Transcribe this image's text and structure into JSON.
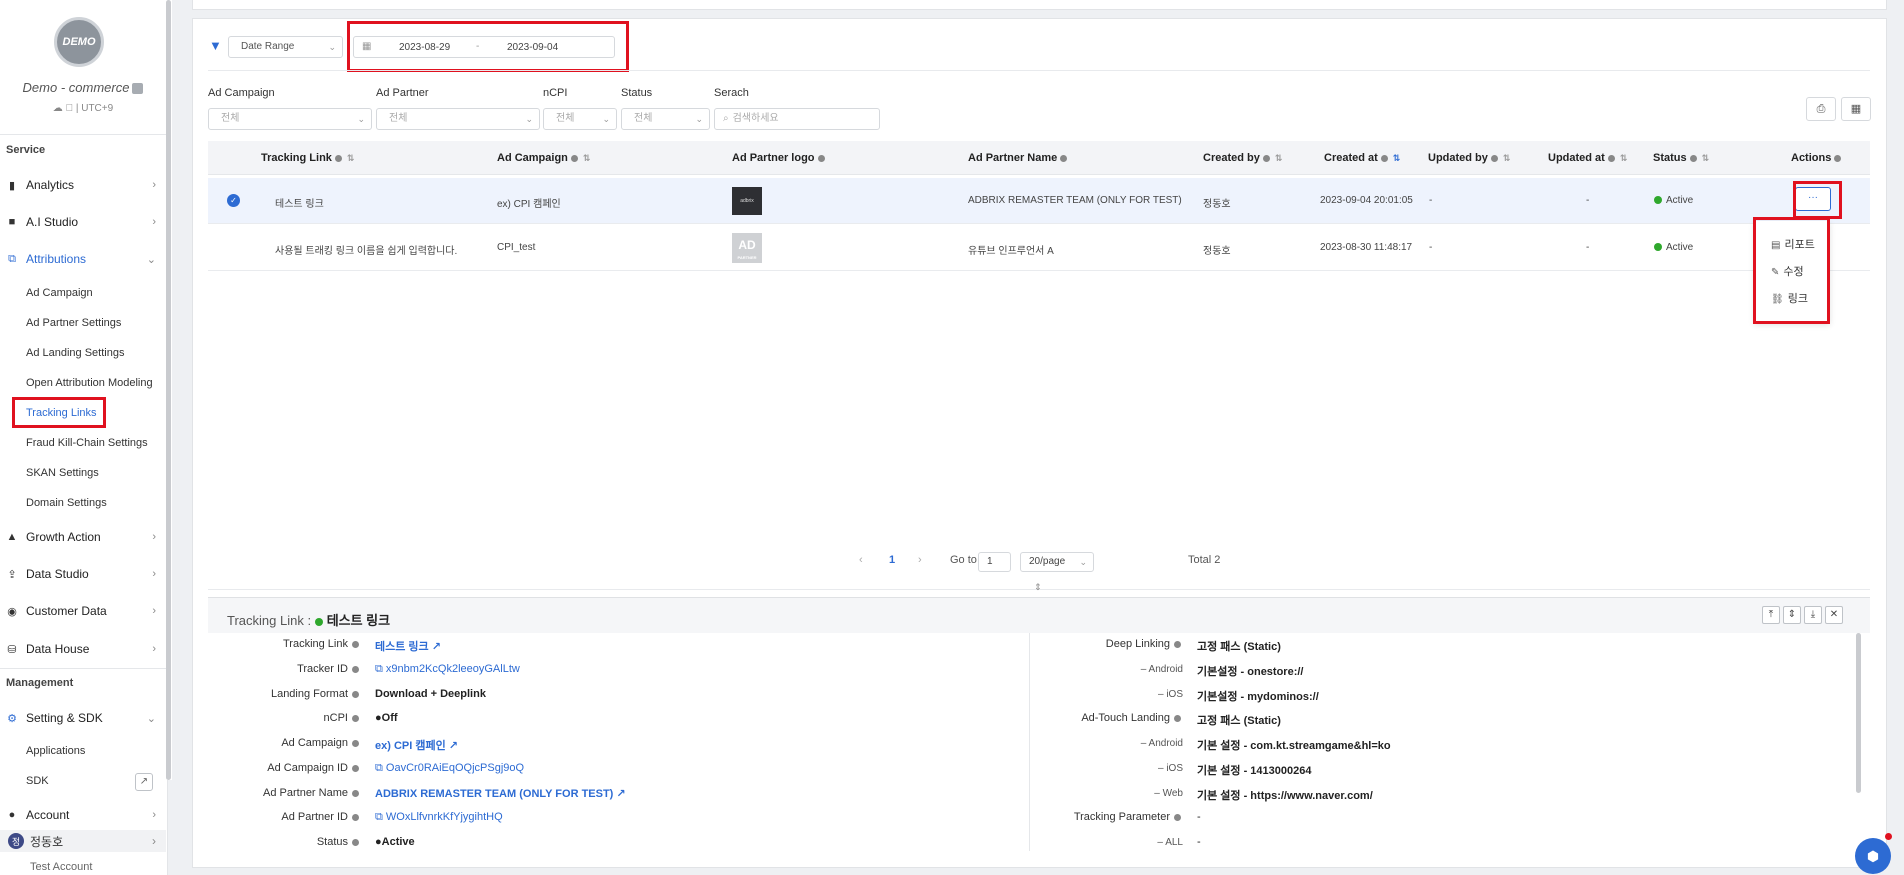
{
  "sidebar": {
    "avatar_text": "DEMO",
    "brand": "Demo - commerce",
    "platform_info": "☁  | UTC+9",
    "section_service": "Service",
    "section_management": "Management",
    "nav": {
      "analytics": "Analytics",
      "ai_studio": "A.I Studio",
      "attributions": "Attributions",
      "growth_action": "Growth Action",
      "data_studio": "Data Studio",
      "customer_data": "Customer Data",
      "data_house": "Data House",
      "setting_sdk": "Setting & SDK",
      "account": "Account"
    },
    "attributions_sub": {
      "ad_campaign": "Ad Campaign",
      "ad_partner_settings": "Ad Partner Settings",
      "ad_landing_settings": "Ad Landing Settings",
      "open_attribution": "Open Attribution Modeling",
      "tracking_links": "Tracking Links",
      "fraud_kill_chain": "Fraud Kill-Chain Settings",
      "skan_settings": "SKAN Settings",
      "domain_settings": "Domain Settings"
    },
    "setting_sub": {
      "applications": "Applications",
      "sdk": "SDK"
    },
    "user_badge": "정",
    "user_name": "정동호",
    "account_name": "Test Account"
  },
  "filters": {
    "date_type": "Date Range",
    "date_start": "2023-08-29",
    "date_sep": "-",
    "date_end": "2023-09-04",
    "labels": {
      "ad_campaign": "Ad Campaign",
      "ad_partner": "Ad Partner",
      "ncpi": "nCPI",
      "status": "Status",
      "search": "Serach"
    },
    "all_value": "전체",
    "search_placeholder": "검색하세요"
  },
  "table": {
    "columns": {
      "tracking_link": "Tracking Link",
      "ad_campaign": "Ad Campaign",
      "ad_partner_logo": "Ad Partner logo",
      "ad_partner_name": "Ad Partner Name",
      "created_by": "Created by",
      "created_at": "Created at",
      "updated_by": "Updated by",
      "updated_at": "Updated at",
      "status": "Status",
      "actions": "Actions"
    },
    "rows": [
      {
        "tracking_link": "테스트 링크",
        "ad_campaign": "ex) CPI 캠페인",
        "logo_text": "adbrix",
        "ad_partner_name": "ADBRIX REMASTER TEAM (ONLY FOR TEST)",
        "created_by": "정동호",
        "created_at": "2023-09-04 20:01:05",
        "updated_by": "-",
        "updated_at": "-",
        "status": "Active"
      },
      {
        "tracking_link": "사용될 트래킹 링크 이름을 쉽게 입력합니다.",
        "ad_campaign": "CPI_test",
        "logo_text": "AD",
        "logo_sub": "PARTNER",
        "ad_partner_name": "유튜브 인프루언서 A",
        "created_by": "정동호",
        "created_at": "2023-08-30 11:48:17",
        "updated_by": "-",
        "updated_at": "-",
        "status": "Active"
      }
    ],
    "more_label": "···"
  },
  "action_menu": {
    "report": "리포트",
    "edit": "수정",
    "link": "링크"
  },
  "pagination": {
    "prev": "‹",
    "current": "1",
    "next": "›",
    "goto_label": "Go to",
    "goto_value": "1",
    "page_size": "20/page",
    "total": "Total 2"
  },
  "detail": {
    "title_label": "Tracking Link :",
    "title_value": "테스트 링크",
    "left": {
      "tracking_link_label": "Tracking Link",
      "tracking_link": "테스트 링크",
      "tracker_id_label": "Tracker ID",
      "tracker_id": "x9nbm2KcQk2leeoyGAlLtw",
      "landing_format_label": "Landing Format",
      "landing_format": "Download + Deeplink",
      "ncpi_label": "nCPI",
      "ncpi": "●Off",
      "ad_campaign_label": "Ad Campaign",
      "ad_campaign": "ex) CPI 캠페인",
      "ad_campaign_id_label": "Ad Campaign ID",
      "ad_campaign_id": "OavCr0RAiEqOQjcPSgj9oQ",
      "ad_partner_name_label": "Ad Partner Name",
      "ad_partner_name": "ADBRIX REMASTER TEAM (ONLY FOR TEST)",
      "ad_partner_id_label": "Ad Partner ID",
      "ad_partner_id": "WOxLlfvnrkKfYjygihtHQ",
      "status_label": "Status",
      "status": "●Active"
    },
    "right": {
      "deep_linking_label": "Deep Linking",
      "deep_linking": "고정 패스 (Static)",
      "dl_android_label": "– Android",
      "dl_android": "기본설정 - onestore://",
      "dl_ios_label": "– iOS",
      "dl_ios": "기본설정 - mydominos://",
      "ad_touch_label": "Ad-Touch Landing",
      "ad_touch": "고정 패스 (Static)",
      "at_android_label": "– Android",
      "at_android": "기본 설정 - com.kt.streamgame&hl=ko",
      "at_ios_label": "– iOS",
      "at_ios": "기본 설정 - 1413000264",
      "at_web_label": "– Web",
      "at_web": "기본 설정 - https://www.naver.com/",
      "tracking_param_label": "Tracking Parameter",
      "tracking_param": "-",
      "all_label": "– ALL",
      "all": "-"
    }
  },
  "colors": {
    "accent": "#2d6bd3",
    "highlight": "#e0111f",
    "active": "#2fa82d"
  }
}
